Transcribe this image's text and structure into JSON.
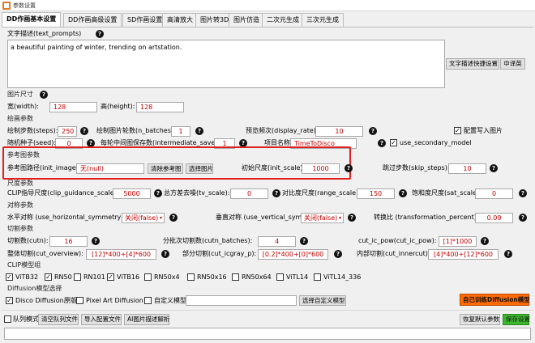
{
  "window": {
    "title": "参数设置"
  },
  "tabs": [
    "DD作画基本设置",
    "DD作画高级设置",
    "SD作画设置",
    "高清放大",
    "图片转3D",
    "图片仿造",
    "二次元生成",
    "三次元生成"
  ],
  "text_prompts": {
    "label": "文字描述(text_prompts)",
    "value": "a beautiful painting of winter, trending on artstation.",
    "btn_quick": "文字描述快捷设置",
    "btn_translate": "中译英"
  },
  "size": {
    "section": "图片尺寸",
    "width_label": "宽(width):",
    "width": "128",
    "height_label": "高(height):",
    "height": "128"
  },
  "draw": {
    "section": "绘画参数",
    "steps_label": "绘制步数(steps):",
    "steps": "250",
    "batches_label": "绘制图片轮数(n_batches):",
    "batches": "1",
    "display_label": "预览频次(display_rate):",
    "display": "10",
    "write_config_label": "配置写入图片",
    "seed_label": "随机种子(seed):",
    "seed": "0",
    "intermediate_label": "每轮中间图保存数(intermediate_saves):",
    "intermediate": "1",
    "project_label": "项目名称",
    "project": "TimeToDisco",
    "secondary_label": "use_secondary_model"
  },
  "ref": {
    "section": "参考图参数",
    "path_label": "参考图路径(init_image):",
    "path": "无(null)",
    "clear_btn": "清除参考图",
    "choose_btn": "选择图片",
    "scale_label": "初始尺度(init_scale):",
    "scale": "1000",
    "skip_label": "跳过步数(skip_steps):",
    "skip": "10"
  },
  "scale": {
    "section": "尺度参数",
    "clip_label": "CLIP指导尺度(clip_guidance_scale):",
    "clip": "5000",
    "tv_label": "总方差去噪(tv_scale):",
    "tv": "0",
    "range_label": "对比度尺度(range_scale):",
    "range": "150",
    "sat_label": "饱和度尺度(sat_scale):",
    "sat": "0"
  },
  "sym": {
    "section": "对称参数",
    "h_label": "水平对称 (use_horizontal_symmetry)",
    "h_value": "关闭(false)",
    "v_label": "垂直对称 (use_vertical_symmetry)",
    "v_value": "关闭(false)",
    "t_label": "转换比 (transformation_percent)",
    "t_value": "0.09"
  },
  "cut": {
    "section": "切割参数",
    "cutn_label": "切割数(cutn):",
    "cutn": "16",
    "batches_label": "分批次切割数(cutn_batches):",
    "batches": "4",
    "pow_label": "cut_ic_pow(cut_ic_pow):",
    "pow": "[1]*1000",
    "overview_label": "整体切割(cut_overview):",
    "overview": "[12]*400+[4]*600",
    "icgray_label": "部分切割(cut_icgray_p):",
    "icgray": "[0.2]*400+[0]*600",
    "inner_label": "内部切割(cut_innercut):",
    "inner": "[4]*400+[12]*600"
  },
  "clip_models": {
    "section": "CLIP模型组",
    "items": [
      {
        "label": "ViTB32",
        "checked": true
      },
      {
        "label": "RN50",
        "checked": true
      },
      {
        "label": "RN101",
        "checked": false
      },
      {
        "label": "ViTB16",
        "checked": true
      },
      {
        "label": "RN50x4",
        "checked": false
      },
      {
        "label": "RN50x16",
        "checked": false
      },
      {
        "label": "RN50x64",
        "checked": false
      },
      {
        "label": "ViTL14",
        "checked": false
      },
      {
        "label": "ViTL14_336",
        "checked": false
      }
    ]
  },
  "diffusion": {
    "section": "Diffusion模型选择",
    "disco_label": "Disco Diffusion原版",
    "disco_checked": true,
    "pixel_label": "Pixel Art Diffusion",
    "pixel_checked": false,
    "custom_label": "自定义模型",
    "custom_checked": false,
    "choose_btn": "选择自定义模型",
    "train_btn": "自己训练Diffusion模型"
  },
  "bottom": {
    "queue_label": "队列模式",
    "clear_queue": "清空队列文件",
    "import_config": "导入配置文件",
    "ai_desc": "AI图片描述解析",
    "restore": "恢复默认参数",
    "save": "保存设置"
  },
  "colors": {
    "highlight": "#e02020",
    "train_btn": "#ff6a00",
    "save_btn": "#3db52e",
    "red_text": "#c00000"
  }
}
